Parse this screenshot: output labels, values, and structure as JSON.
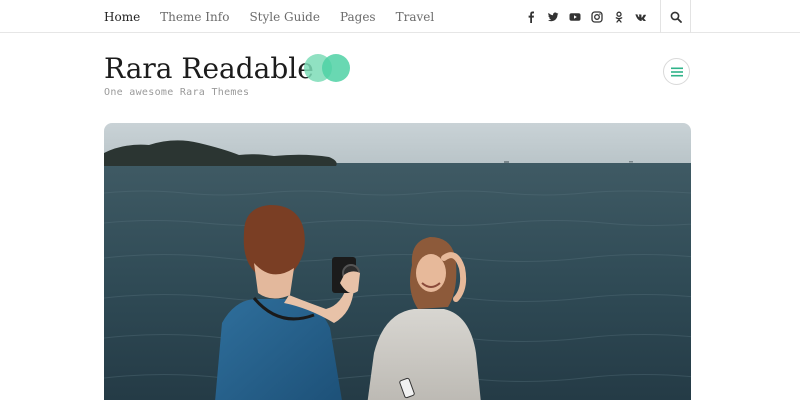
{
  "nav": {
    "items": [
      {
        "label": "Home",
        "active": true
      },
      {
        "label": "Theme Info",
        "active": false
      },
      {
        "label": "Style Guide",
        "active": false
      },
      {
        "label": "Pages",
        "active": false
      },
      {
        "label": "Travel",
        "active": false
      }
    ]
  },
  "social": {
    "icons": [
      "facebook-icon",
      "twitter-icon",
      "youtube-icon",
      "instagram-icon",
      "odnoklassniki-icon",
      "vk-icon"
    ]
  },
  "header": {
    "site_title": "Rara Readable",
    "tagline": "One awesome Rara Themes"
  },
  "colors": {
    "accent": "#4fd1a5",
    "accent_dark": "#2fb389",
    "text": "#1c1c1c",
    "muted": "#9a9a9a"
  },
  "hero": {
    "image": "featured-image-two-women-by-sea"
  }
}
